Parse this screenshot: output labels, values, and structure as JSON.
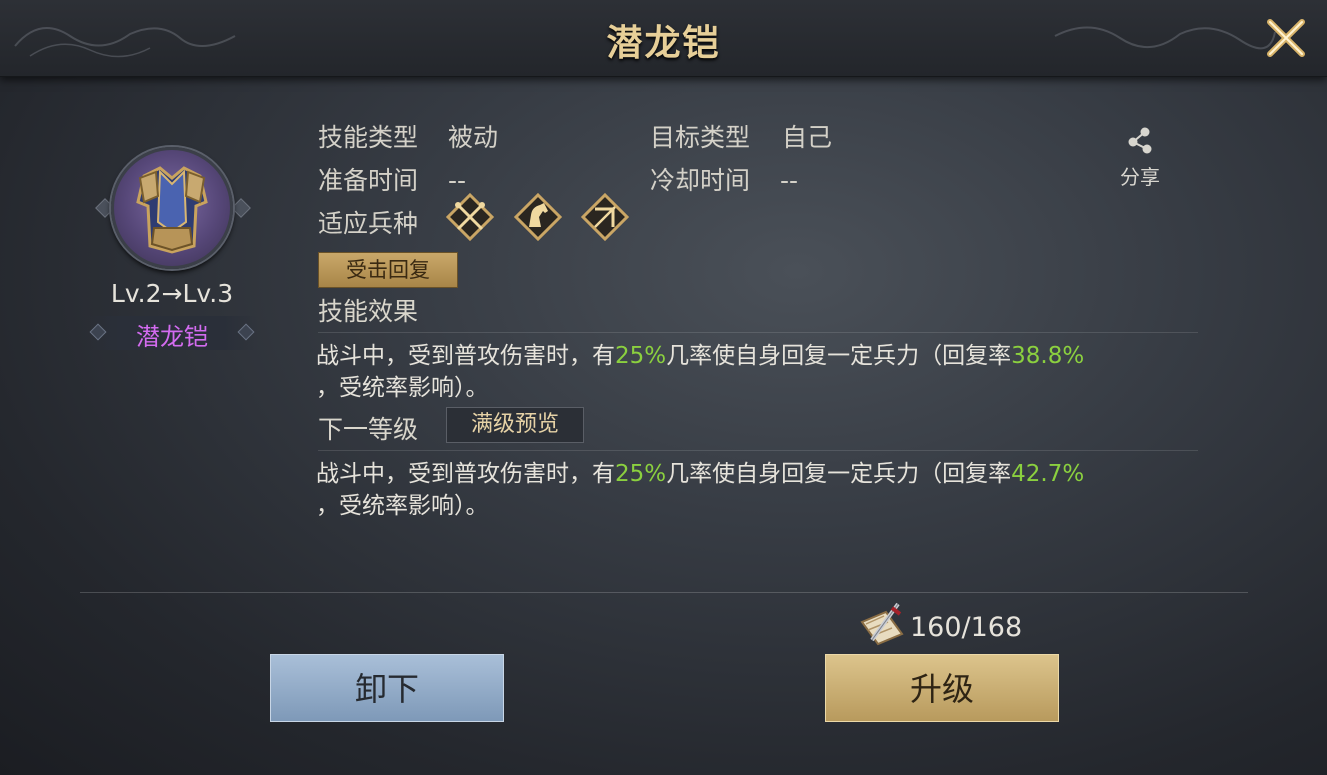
{
  "header": {
    "title": "潜龙铠"
  },
  "item": {
    "level_text": "Lv.2→Lv.3",
    "name": "潜龙铠",
    "name_color": "#d36bf0"
  },
  "info": {
    "skill_type_label": "技能类型",
    "skill_type_value": "被动",
    "target_type_label": "目标类型",
    "target_type_value": "自己",
    "prep_time_label": "准备时间",
    "prep_time_value": "--",
    "cooldown_label": "冷却时间",
    "cooldown_value": "--",
    "unit_type_label": "适应兵种",
    "unit_icons": [
      "crossed-spears-icon",
      "horse-icon",
      "bow-icon"
    ]
  },
  "share": {
    "label": "分享",
    "icon": "share-icon"
  },
  "tag": {
    "label": "受击回复"
  },
  "effect": {
    "heading": "技能效果",
    "line1_a": "战斗中，受到普攻伤害时，有",
    "line1_pct": "25%",
    "line1_b": "几率使自身回复一定兵力（回复率",
    "line1_rate": "38.8%",
    "line2": "，受统率影响）。"
  },
  "next_level": {
    "heading": "下一等级",
    "preview_button": "满级预览",
    "line1_a": "战斗中，受到普攻伤害时，有",
    "line1_pct": "25%",
    "line1_b": "几率使自身回复一定兵力（回复率",
    "line1_rate": "42.7%",
    "line2": "，受统率影响）。"
  },
  "cost": {
    "value": "160/168",
    "icon": "scroll-sword-icon"
  },
  "buttons": {
    "unequip": "卸下",
    "upgrade": "升级"
  },
  "colors": {
    "highlight_green": "#8bd03f",
    "title_gold": "#e7cf98"
  }
}
